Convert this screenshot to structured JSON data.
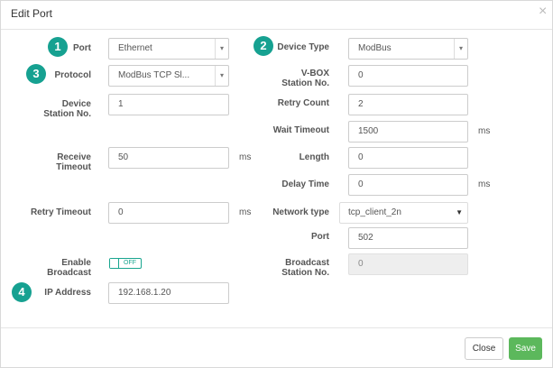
{
  "dialog": {
    "title": "Edit Port",
    "close_icon": "×"
  },
  "left": {
    "port": {
      "label": "Port",
      "value": "Ethernet"
    },
    "protocol": {
      "label": "Protocol",
      "value": "ModBus TCP Sl..."
    },
    "device_station": {
      "label_1": "Device",
      "label_2": "Station No.",
      "value": "1"
    },
    "receive_timeout": {
      "label_1": "Receive",
      "label_2": "Timeout",
      "value": "50",
      "unit": "ms"
    },
    "retry_timeout": {
      "label": "Retry Timeout",
      "value": "0",
      "unit": "ms"
    },
    "enable_broadcast": {
      "label_1": "Enable",
      "label_2": "Broadcast",
      "state": "OFF"
    },
    "ip_address": {
      "label": "IP Address",
      "value": "192.168.1.20"
    }
  },
  "right": {
    "device_type": {
      "label": "Device Type",
      "value": "ModBus"
    },
    "vbox_station": {
      "label_1": "V-BOX",
      "label_2": "Station No.",
      "value": "0"
    },
    "retry_count": {
      "label": "Retry Count",
      "value": "2"
    },
    "wait_timeout": {
      "label": "Wait Timeout",
      "value": "1500",
      "unit": "ms"
    },
    "length": {
      "label": "Length",
      "value": "0"
    },
    "delay_time": {
      "label": "Delay Time",
      "value": "0",
      "unit": "ms"
    },
    "network_type": {
      "label": "Network type",
      "value": "tcp_client_2n"
    },
    "port": {
      "label": "Port",
      "value": "502"
    },
    "broadcast_station": {
      "label_1": "Broadcast",
      "label_2": "Station No.",
      "value": "0"
    }
  },
  "badges": {
    "b1": "1",
    "b2": "2",
    "b3": "3",
    "b4": "4"
  },
  "footer": {
    "close_label": "Close",
    "save_label": "Save"
  },
  "colors": {
    "accent": "#16a191",
    "save": "#5cb85c"
  }
}
